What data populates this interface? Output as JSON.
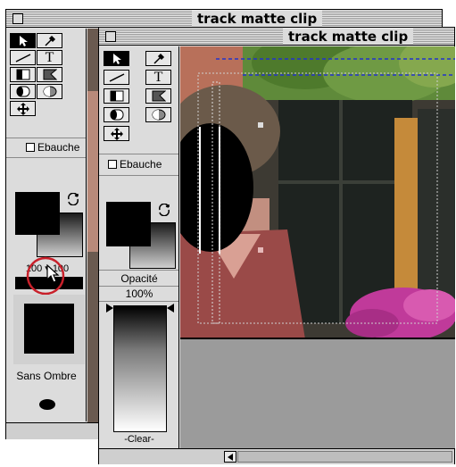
{
  "back_window": {
    "title": "track matte clip",
    "ebauche_label": "Ebauche",
    "opacity_range": "100 ▾ 100",
    "shadow_label": "Sans Ombre"
  },
  "front_window": {
    "title": "track matte clip",
    "ebauche_label": "Ebauche",
    "opacity_title": "Opacité",
    "opacity_value": "100%",
    "clear_label": "-Clear-"
  },
  "tools": [
    "arrow-select",
    "eyedropper",
    "line",
    "text",
    "rect-mask",
    "gradient-mask",
    "rect-shape",
    "gradient-shape",
    "oval-shape",
    "oval-gradient",
    "move-handle"
  ],
  "colors": {
    "window_bg": "#dcdcdc",
    "matte_black": "#000000",
    "selection_blue": "#2233cc",
    "highlight_red": "#c8202a"
  }
}
